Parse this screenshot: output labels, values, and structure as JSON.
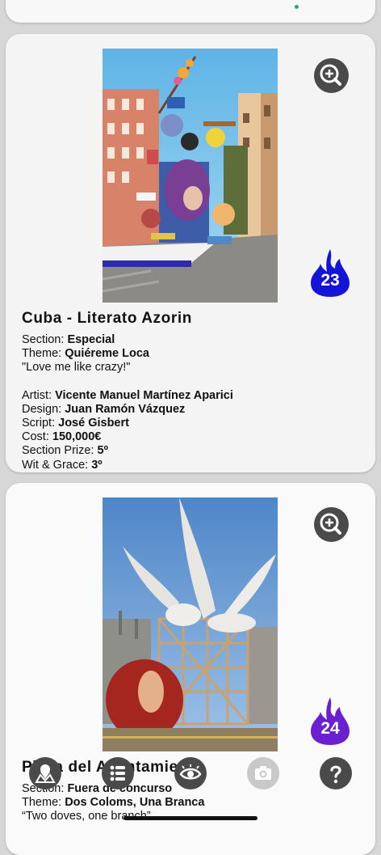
{
  "colors": {
    "card_background": "#f4f4f4",
    "page_background": "#d7d7d7",
    "button_dark": "#4a4a4a",
    "flame_blue": "#1414d8",
    "flame_purple": "#6a1fd0"
  },
  "cards": [
    {
      "rank": "23",
      "flame_color": "#1414d8",
      "title": "Cuba - Literato Azorin",
      "section_label": "Section:",
      "section_value": "Especial",
      "theme_label": "Theme:",
      "theme_value": "Quiéreme Loca",
      "translation": "\"Love me like crazy!\"",
      "artist_label": "Artist:",
      "artist_value": "Vicente Manuel Martínez Aparici",
      "design_label": "Design:",
      "design_value": "Juan Ramón Vázquez",
      "script_label": "Script:",
      "script_value": "José Gisbert",
      "cost_label": "Cost:",
      "cost_value": "150,000€",
      "prize_label": "Section Prize:",
      "prize_value": "5º",
      "wit_label": "Wit & Grace:",
      "wit_value": "3º",
      "image_icon": "falla-monument-photo"
    },
    {
      "rank": "24",
      "flame_color": "#6a1fd0",
      "title": "Plaza del Ayuntamiento",
      "section_label": "Section:",
      "section_value": "Fuera de concurso",
      "theme_label": "Theme:",
      "theme_value": "Dos Coloms, Una Branca",
      "translation": "“Two doves, one branch”",
      "image_icon": "doves-monument-photo"
    }
  ],
  "nav": {
    "items": [
      "map-icon",
      "list-icon",
      "eye-icon",
      "camera-icon",
      "help-icon"
    ]
  }
}
